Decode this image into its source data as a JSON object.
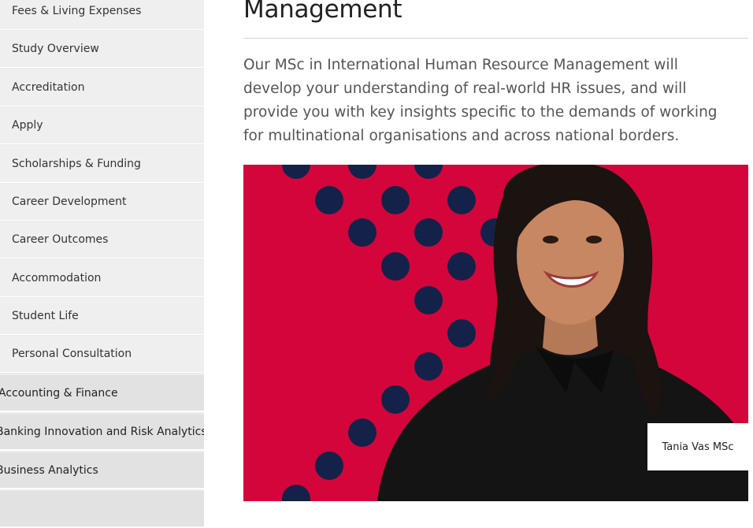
{
  "sidebar": {
    "items": [
      {
        "label": "Fees & Living Expenses"
      },
      {
        "label": "Study Overview"
      },
      {
        "label": "Accreditation"
      },
      {
        "label": "Apply"
      },
      {
        "label": "Scholarships & Funding"
      },
      {
        "label": "Career Development"
      },
      {
        "label": "Career Outcomes"
      },
      {
        "label": "Accommodation"
      },
      {
        "label": "Student Life"
      },
      {
        "label": "Personal Consultation"
      }
    ],
    "categories": [
      {
        "label": "Accounting & Finance"
      },
      {
        "label": "Banking Innovation and Risk Analytics"
      },
      {
        "label": "Business Analytics"
      }
    ]
  },
  "main": {
    "title": "Management",
    "intro": "Our MSc in International Human Resource Management will develop your understanding of real-world HR issues, and will provide you with key insights specific to the demands of working for multinational organisations and across national borders.",
    "image_caption": "Tania Vas MSc"
  },
  "colors": {
    "photo_background": "#d4053b",
    "dot": "#14224a",
    "sidebar_item": "#efefef",
    "sidebar_category": "#e2e2e2"
  }
}
